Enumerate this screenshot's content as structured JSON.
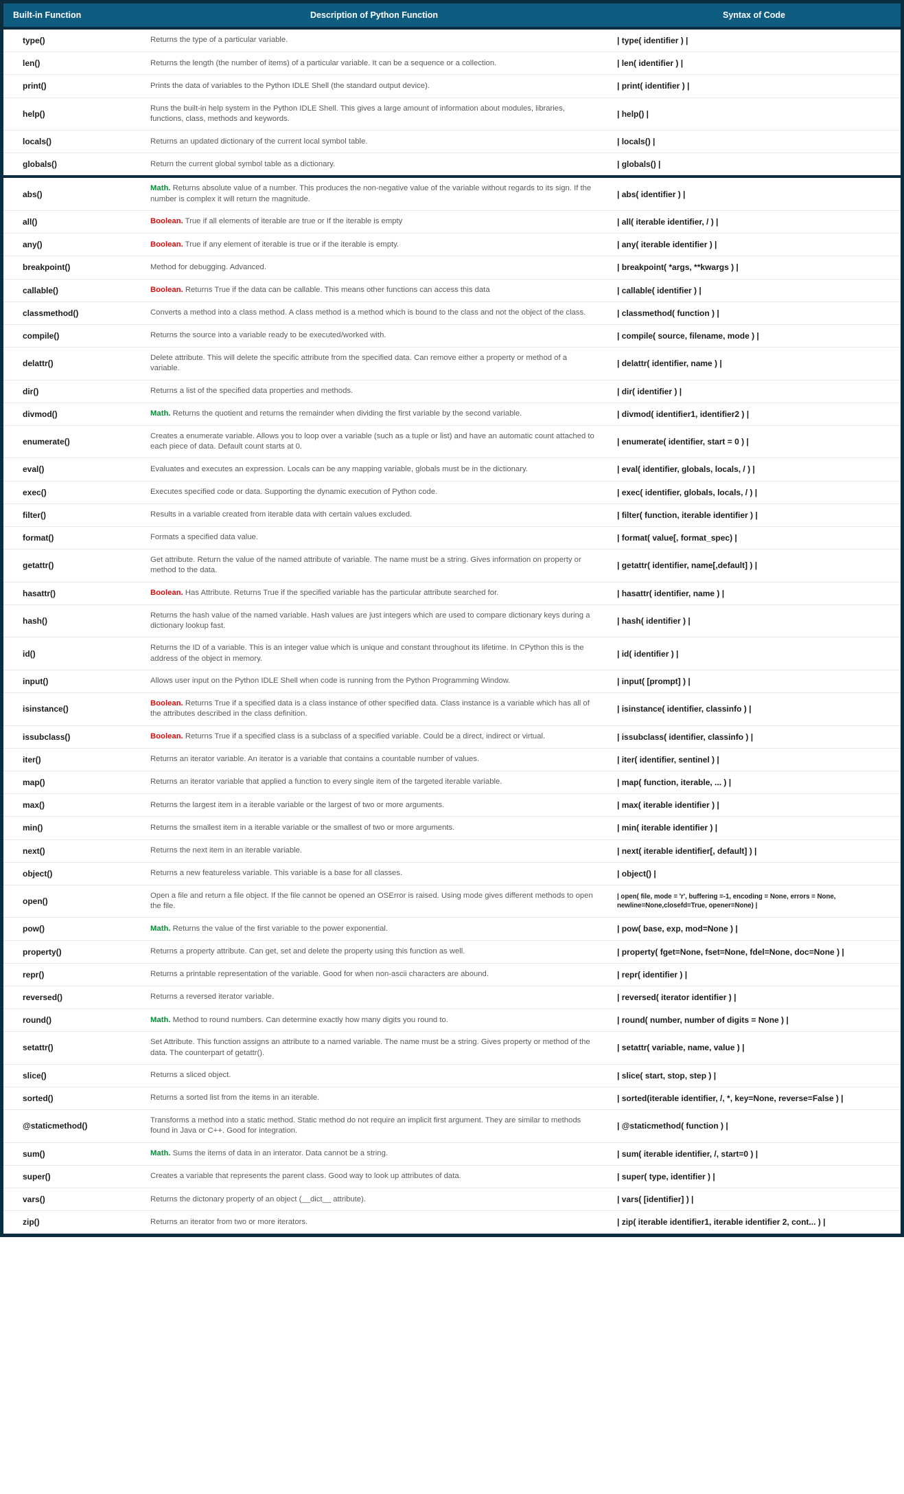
{
  "headers": {
    "col1": "Built-in Function",
    "col2": "Description of Python Function",
    "col3": "Syntax of Code"
  },
  "tags": {
    "math": "Math.",
    "bool": "Boolean."
  },
  "rows": [
    {
      "fn": "type()",
      "tag": null,
      "desc": "Returns the type of a particular variable.",
      "syn": "| type( identifier ) |"
    },
    {
      "fn": "len()",
      "tag": null,
      "desc": "Returns the length (the number of items) of a particular variable. It can be a sequence or a collection.",
      "syn": "| len( identifier ) |"
    },
    {
      "fn": "print()",
      "tag": null,
      "desc": "Prints the data of variables to the Python IDLE Shell (the standard output device).",
      "syn": "| print( identifier ) |"
    },
    {
      "fn": "help()",
      "tag": null,
      "desc": "Runs the built-in help system in the Python IDLE Shell. This gives a large amount of information about modules, libraries, functions, class, methods and keywords.",
      "syn": "| help() |"
    },
    {
      "fn": "locals()",
      "tag": null,
      "desc": "Returns an updated dictionary of the current local symbol table.",
      "syn": "| locals() |"
    },
    {
      "fn": "globals()",
      "tag": null,
      "desc": "Return the current global symbol table as a dictionary.",
      "syn": "| globals() |"
    },
    {
      "fn": "abs()",
      "tag": "math",
      "desc": "Returns absolute value of a number. This produces the non-negative value of the variable without regards to its sign. If the number is complex it will return the magnitude.",
      "syn": "| abs( identifier ) |",
      "section": true
    },
    {
      "fn": "all()",
      "tag": "bool",
      "desc": "True if all elements of iterable are true or If the iterable is empty",
      "syn": "| all( iterable identifier, / ) |"
    },
    {
      "fn": "any()",
      "tag": "bool",
      "desc": "True if any element of iterable is true or if the iterable is empty.",
      "syn": "| any( iterable identifier ) |"
    },
    {
      "fn": "breakpoint()",
      "tag": null,
      "desc": "Method for debugging. Advanced.",
      "syn": "| breakpoint( *args, **kwargs ) |"
    },
    {
      "fn": "callable()",
      "tag": "bool",
      "desc": "Returns True if the data can be callable. This means other functions can access this data",
      "syn": "| callable( identifier ) |"
    },
    {
      "fn": "classmethod()",
      "tag": null,
      "desc": "Converts a method into a class method. A class method is a method which is bound to the class and not the object of the class.",
      "syn": "| classmethod( function ) |"
    },
    {
      "fn": "compile()",
      "tag": null,
      "desc": "Returns the source into a variable ready to be executed/worked with.",
      "syn": "| compile( source, filename, mode ) |"
    },
    {
      "fn": "delattr()",
      "tag": null,
      "desc": "Delete attribute. This will delete the specific attribute from the specified data. Can remove either a property or method of a variable.",
      "syn": "| delattr( identifier, name ) |"
    },
    {
      "fn": "dir()",
      "tag": null,
      "desc": "Returns a list of the specified data properties and methods.",
      "syn": "| dir( identifier ) |"
    },
    {
      "fn": "divmod()",
      "tag": "math",
      "desc": "Returns the quotient and returns the remainder when dividing the first variable by the second variable.",
      "syn": "| divmod( identifier1, identifier2 ) |"
    },
    {
      "fn": "enumerate()",
      "tag": null,
      "desc": "Creates a enumerate variable. Allows you to loop over a variable (such as a tuple or list) and have an automatic count attached to each piece of data. Default count starts at 0.",
      "syn": "| enumerate( identifier, start = 0 ) |"
    },
    {
      "fn": "eval()",
      "tag": null,
      "desc": "Evaluates and executes an expression. Locals can be any mapping variable, globals must be in the dictionary.",
      "syn": "| eval( identifier, globals, locals, / ) |"
    },
    {
      "fn": "exec()",
      "tag": null,
      "desc": "Executes specified code or data. Supporting the dynamic execution of Python code.",
      "syn": "| exec( identifier, globals, locals, / ) |"
    },
    {
      "fn": "filter()",
      "tag": null,
      "desc": "Results in a variable created from iterable data with certain values excluded.",
      "syn": "| filter( function, iterable identifier ) |"
    },
    {
      "fn": "format()",
      "tag": null,
      "desc": "Formats a specified data value.",
      "syn": "| format( value[, format_spec) |"
    },
    {
      "fn": "getattr()",
      "tag": null,
      "desc": "Get attribute. Return the value of the named attribute of variable. The name must be a string. Gives information on property or method to the data.",
      "syn": "| getattr( identifier, name[,default] ) |"
    },
    {
      "fn": "hasattr()",
      "tag": "bool",
      "desc": "Has Attribute. Returns True if the specified variable has the particular attribute searched for.",
      "syn": "| hasattr( identifier, name ) |"
    },
    {
      "fn": "hash()",
      "tag": null,
      "desc": "Returns the hash value of the named variable. Hash values are just integers which are used to compare dictionary keys during a dictionary lookup fast.",
      "syn": "| hash( identifier ) |"
    },
    {
      "fn": "id()",
      "tag": null,
      "desc": "Returns the ID of a variable. This is an integer value which is unique and constant throughout its lifetime. In CPython this is the address of the object in memory.",
      "syn": "| id( identifier ) |"
    },
    {
      "fn": "input()",
      "tag": null,
      "desc": "Allows user input on the Python IDLE Shell when code is running from the Python Programming Window.",
      "syn": "| input( [prompt] ) |"
    },
    {
      "fn": "isinstance()",
      "tag": "bool",
      "desc": "Returns True if a specified data is a class instance of other specified data. Class instance is a variable which has all of the attributes described in the class definition.",
      "syn": "| isinstance( identifier, classinfo ) |"
    },
    {
      "fn": "issubclass()",
      "tag": "bool",
      "desc": "Returns True if a specified class is a subclass of a specified variable. Could be a direct, indirect or virtual.",
      "syn": "| issubclass( identifier, classinfo ) |"
    },
    {
      "fn": "iter()",
      "tag": null,
      "desc": "Returns an iterator variable. An iterator is a variable that contains a countable number of values.",
      "syn": "| iter( identifier, sentinel ) |"
    },
    {
      "fn": "map()",
      "tag": null,
      "desc": "Returns an iterator variable that applied a function to every single item of the targeted iterable variable.",
      "syn": "| map( function, iterable, ... ) |"
    },
    {
      "fn": "max()",
      "tag": null,
      "desc": "Returns the largest item in a iterable variable or the largest of two or more arguments.",
      "syn": "| max( iterable identifier ) |"
    },
    {
      "fn": "min()",
      "tag": null,
      "desc": "Returns the smallest item in a iterable variable or the smallest of two or more arguments.",
      "syn": "| min( iterable identifier ) |"
    },
    {
      "fn": "next()",
      "tag": null,
      "desc": "Returns the next item in an iterable variable.",
      "syn": "| next( iterable identifier[, default] ) |"
    },
    {
      "fn": "object()",
      "tag": null,
      "desc": "Returns a new featureless variable. This variable is a base for all classes.",
      "syn": "| object() |"
    },
    {
      "fn": "open()",
      "tag": null,
      "desc": "Open a file and return a file object. If the file cannot be opened an OSError is raised. Using mode gives different methods to open the file.",
      "syn": "| open( file, mode = 'r', buffering =-1, encoding = None, errors = None, newline=None,closefd=True, opener=None) |",
      "small": true
    },
    {
      "fn": "pow()",
      "tag": "math",
      "desc": "Returns the value of the first variable to the power exponential.",
      "syn": "| pow( base, exp, mod=None ) |"
    },
    {
      "fn": "property()",
      "tag": null,
      "desc": "Returns a property attribute. Can get, set and delete the property using this function as well.",
      "syn": "| property( fget=None, fset=None, fdel=None, doc=None ) |"
    },
    {
      "fn": "repr()",
      "tag": null,
      "desc": "Returns a printable representation of the variable. Good for when non-ascii characters are abound.",
      "syn": "| repr( identifier ) |"
    },
    {
      "fn": "reversed()",
      "tag": null,
      "desc": "Returns a reversed iterator variable.",
      "syn": "| reversed( iterator identifier ) |"
    },
    {
      "fn": "round()",
      "tag": "math",
      "desc": "Method to round numbers. Can determine exactly how many digits you round to.",
      "syn": "| round( number, number of digits = None ) |"
    },
    {
      "fn": "setattr()",
      "tag": null,
      "desc": "Set Attribute. This function assigns an attribute to a named variable. The name must be a string. Gives property or method of the data. The counterpart of getattr().",
      "syn": "| setattr( variable, name, value ) |"
    },
    {
      "fn": "slice()",
      "tag": null,
      "desc": "Returns a sliced object.",
      "syn": "| slice( start, stop, step ) |"
    },
    {
      "fn": "sorted()",
      "tag": null,
      "desc": "Returns a sorted list from the items in an iterable.",
      "syn": "| sorted(iterable identifier, /, *, key=None, reverse=False ) |"
    },
    {
      "fn": "@staticmethod()",
      "tag": null,
      "desc": "Transforms a method into a static method. Static method do not require an implicit first argument. They are similar to methods found in Java or C++. Good for integration.",
      "syn": "| @staticmethod( function ) |"
    },
    {
      "fn": "sum()",
      "tag": "math",
      "desc": "Sums the items of data in an interator. Data cannot be a string.",
      "syn": "| sum( iterable identifier, /, start=0 ) |"
    },
    {
      "fn": "super()",
      "tag": null,
      "desc": "Creates a variable that represents the parent class. Good way to look up attributes of data.",
      "syn": "| super( type, identifier ) |"
    },
    {
      "fn": "vars()",
      "tag": null,
      "desc": "Returns the dictonary property of an object (__dict__ attribute).",
      "syn": "| vars( [identifier] ) |"
    },
    {
      "fn": "zip()",
      "tag": null,
      "desc": "Returns an iterator from two or more iterators.",
      "syn": "| zip( iterable identifier1, iterable identifier 2, cont... ) |"
    }
  ]
}
